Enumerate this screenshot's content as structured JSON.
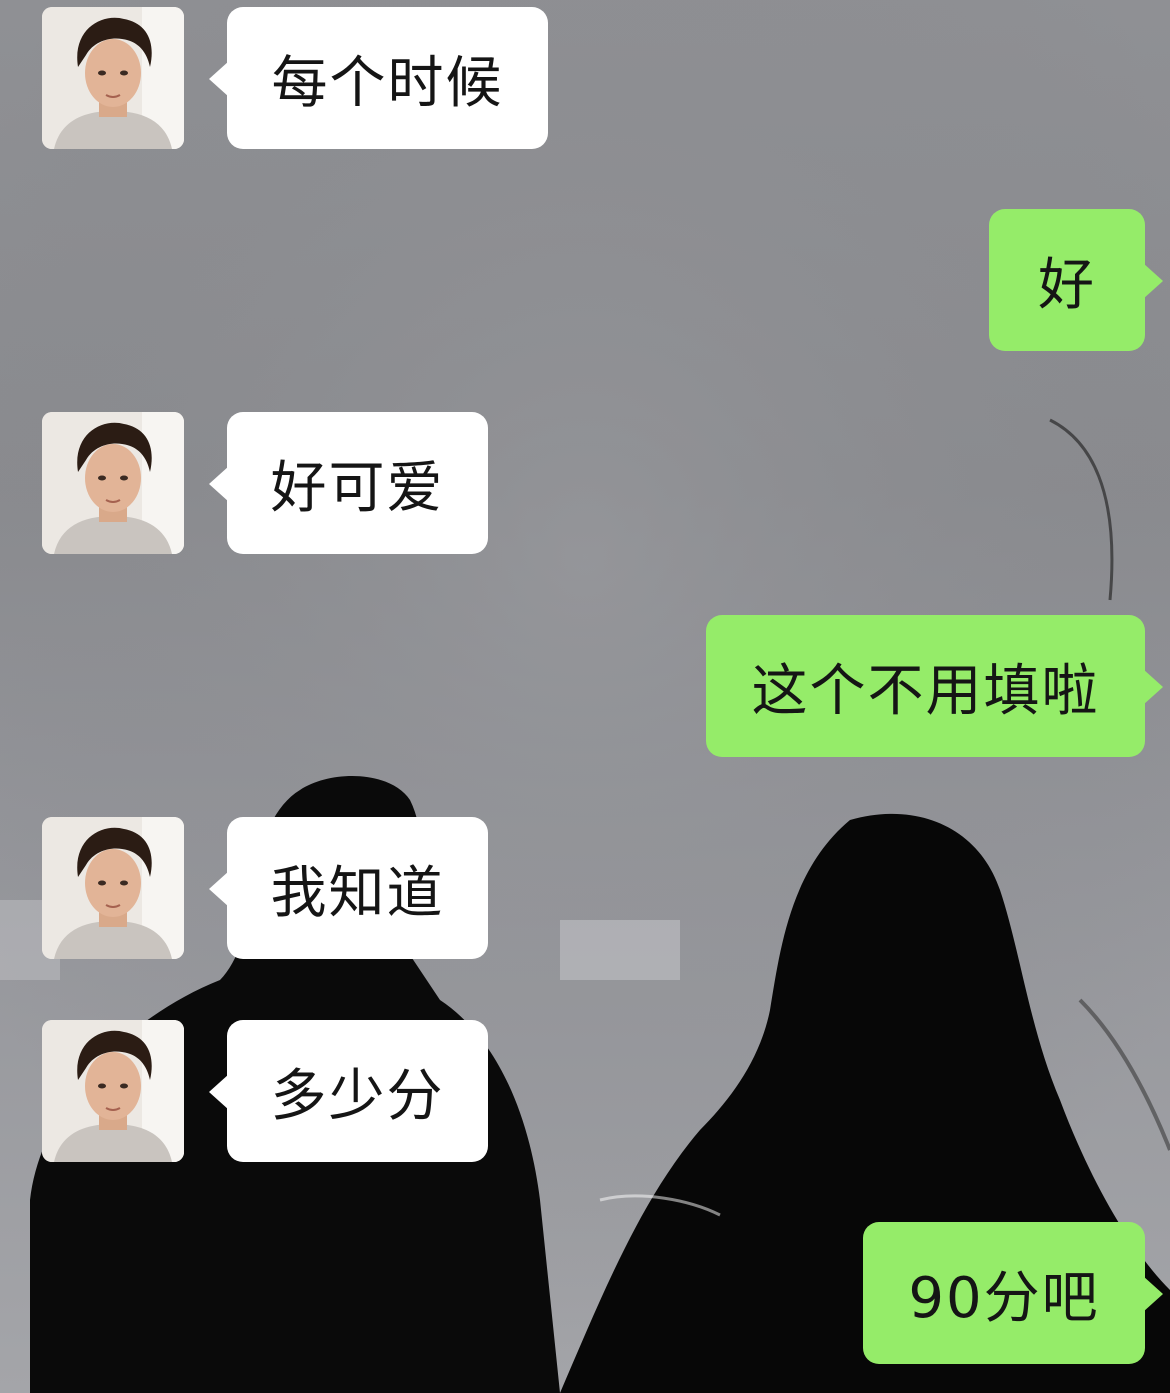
{
  "chat": {
    "background": "dark-silhouette-photo",
    "bubble_colors": {
      "incoming": "#ffffff",
      "outgoing": "#95ec69"
    },
    "messages": [
      {
        "from": "other",
        "text": "每个时候"
      },
      {
        "from": "me",
        "text": "好"
      },
      {
        "from": "other",
        "text": "好可爱"
      },
      {
        "from": "me",
        "text": "这个不用填啦"
      },
      {
        "from": "other",
        "text": "我知道"
      },
      {
        "from": "other",
        "text": "多少分"
      },
      {
        "from": "me",
        "text": "90分吧"
      }
    ]
  }
}
